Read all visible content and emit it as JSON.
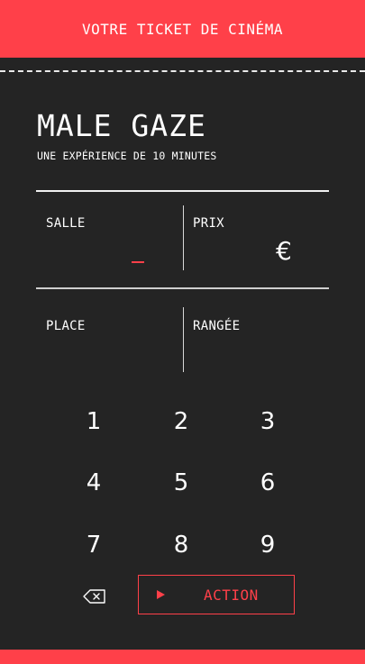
{
  "header": {
    "title": "VOTRE TICKET DE CINÉMA"
  },
  "movie": {
    "title": "MALE GAZE",
    "subtitle": "UNE EXPÉRIENCE DE 10 MINUTES"
  },
  "fields": {
    "salle_label": "SALLE",
    "prix_label": "PRIX",
    "currency": "€",
    "place_label": "PLACE",
    "rangee_label": "RANGÉE"
  },
  "keypad": {
    "keys": [
      "1",
      "2",
      "3",
      "4",
      "5",
      "6",
      "7",
      "8",
      "9"
    ]
  },
  "action": {
    "label": "ACTION"
  },
  "icons": {
    "backspace": "backspace-icon",
    "play": "play-icon"
  },
  "colors": {
    "accent": "#ff4049",
    "background": "#242424",
    "text": "#ffffff"
  }
}
